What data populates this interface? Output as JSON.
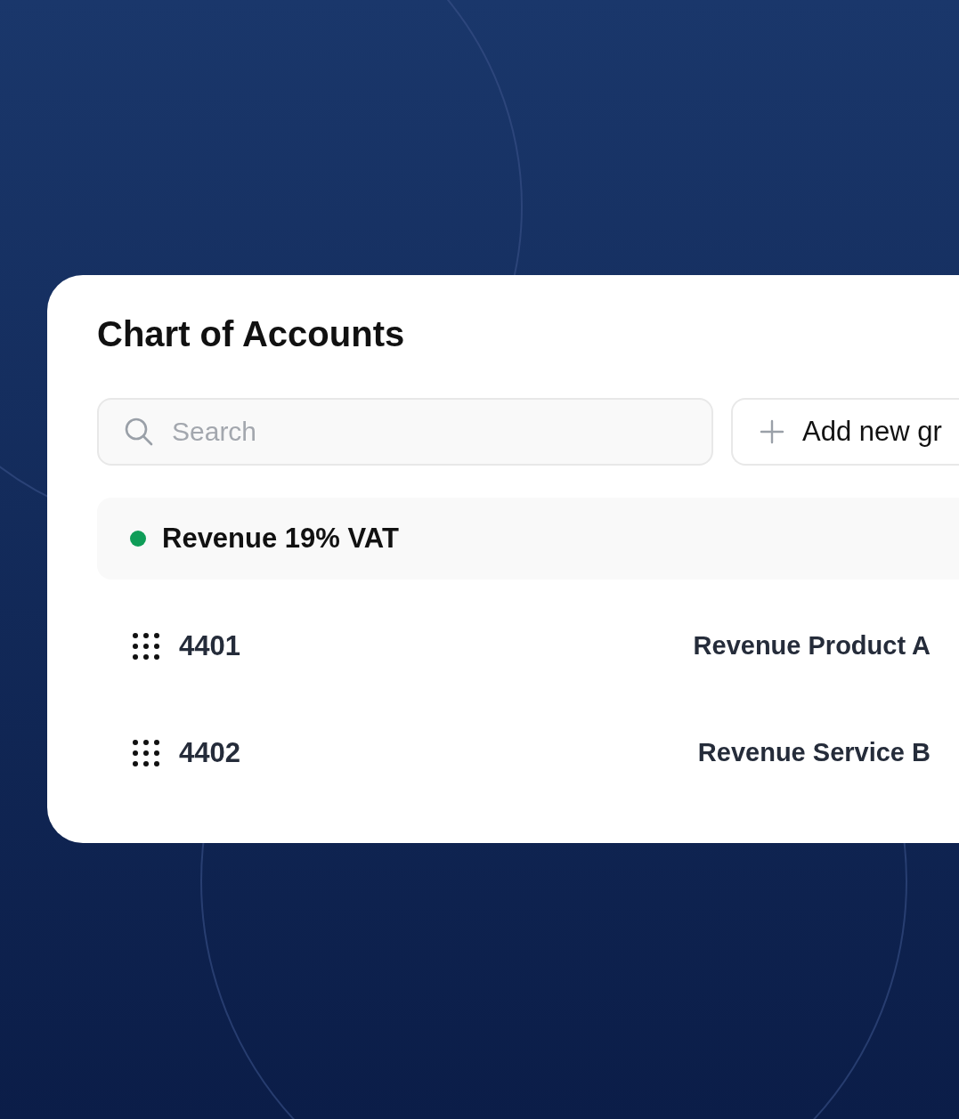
{
  "title": "Chart of Accounts",
  "search": {
    "placeholder": "Search"
  },
  "add_button": {
    "label": "Add new gr"
  },
  "group": {
    "name": "Revenue 19% VAT",
    "color": "#0f9d58",
    "accounts": [
      {
        "code": "4401",
        "name": "Revenue Product A"
      },
      {
        "code": "4402",
        "name": "Revenue Service B"
      }
    ]
  }
}
